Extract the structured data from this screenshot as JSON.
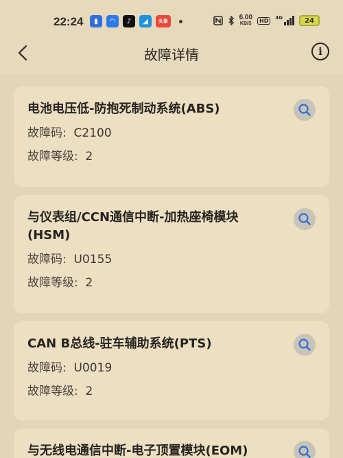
{
  "status_bar": {
    "time": "22:24",
    "app_icons": [
      {
        "name": "app-icon-1",
        "glyph": "▮",
        "color": "#2f6fdf"
      },
      {
        "name": "app-icon-2",
        "glyph": "◠",
        "color": "#2d7be8"
      },
      {
        "name": "tiktok-icon",
        "glyph": "♪",
        "color": "#111111"
      },
      {
        "name": "app-icon-4",
        "glyph": "◢",
        "color": "#2090e0"
      },
      {
        "name": "toutiao-icon",
        "glyph": "头条",
        "color": "#e64a3b"
      }
    ],
    "speed_value": "6.00",
    "speed_unit": "KB/S",
    "hd": "HD",
    "network": "4G",
    "battery": "24"
  },
  "nav": {
    "title": "故障详情",
    "info_glyph": "i"
  },
  "faults": [
    {
      "title": "电池电压低-防抱死制动系统(ABS)",
      "code_label": "故障码:",
      "code": "C2100",
      "level_label": "故障等级:",
      "level": "2"
    },
    {
      "title": "与仪表组/CCN通信中断-加热座椅模块(HSM)",
      "code_label": "故障码:",
      "code": "U0155",
      "level_label": "故障等级:",
      "level": "2"
    },
    {
      "title": "CAN B总线-驻车辅助系统(PTS)",
      "code_label": "故障码:",
      "code": "U0019",
      "level_label": "故障等级:",
      "level": "2"
    },
    {
      "title": "与无线电通信中断-电子顶置模块(EOM)",
      "code_label": "",
      "code": "",
      "level_label": "",
      "level": ""
    }
  ],
  "colors": {
    "background": "#e2d5b8",
    "card": "#ecdfc2",
    "search_accent": "#2f6fd6"
  }
}
